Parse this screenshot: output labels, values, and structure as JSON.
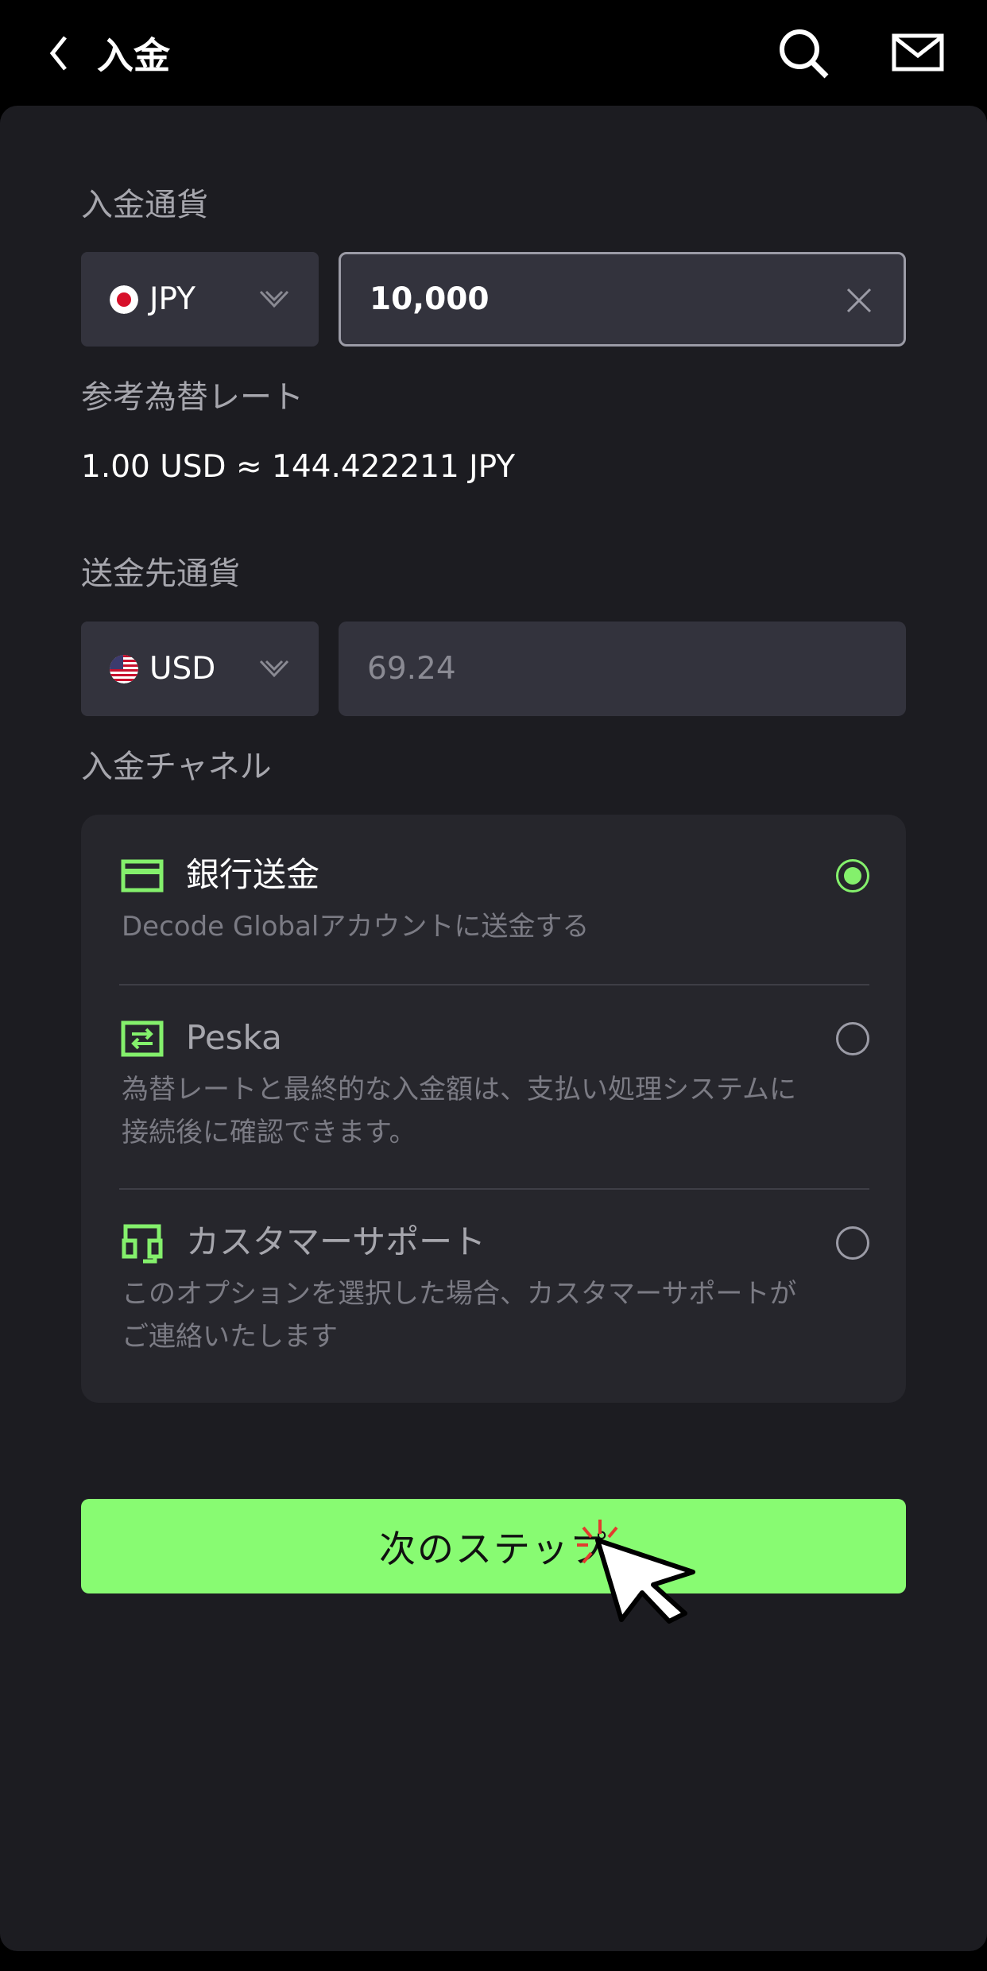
{
  "header": {
    "title": "入金"
  },
  "deposit": {
    "currency_label": "入金通貨",
    "currency": "JPY",
    "amount": "10,000"
  },
  "rate": {
    "label": "参考為替レート",
    "text": "1.00 USD ≈ 144.422211 JPY"
  },
  "target": {
    "currency_label": "送金先通貨",
    "currency": "USD",
    "amount": "69.24"
  },
  "channels": {
    "label": "入金チャネル",
    "items": [
      {
        "title": "銀行送金",
        "desc": "Decode Globalアカウントに送金する",
        "selected": true,
        "icon": "card-icon"
      },
      {
        "title": "Peska",
        "desc": "為替レートと最終的な入金額は、支払い処理システムに接続後に確認できます。",
        "selected": false,
        "icon": "transfer-icon"
      },
      {
        "title": "カスタマーサポート",
        "desc": "このオプションを選択した場合、カスタマーサポートがご連絡いたします",
        "selected": false,
        "icon": "headset-icon"
      }
    ]
  },
  "actions": {
    "next_label": "次のステップ"
  },
  "colors": {
    "accent": "#88fb72",
    "background": "#000000",
    "panel": "#1c1c21",
    "field": "#33333d"
  }
}
